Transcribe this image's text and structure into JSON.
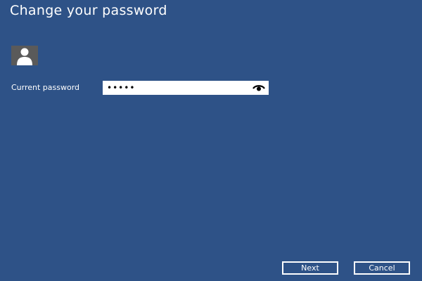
{
  "page": {
    "title": "Change your password"
  },
  "user": {
    "avatar_icon": "user-silhouette-icon"
  },
  "form": {
    "current_password_label": "Current password",
    "current_password_value": "•••••",
    "reveal_icon": "eye-icon"
  },
  "buttons": {
    "next_label": "Next",
    "cancel_label": "Cancel"
  },
  "colors": {
    "background": "#2e5287",
    "avatar_bg": "#5a5a5a",
    "text": "#ffffff"
  }
}
